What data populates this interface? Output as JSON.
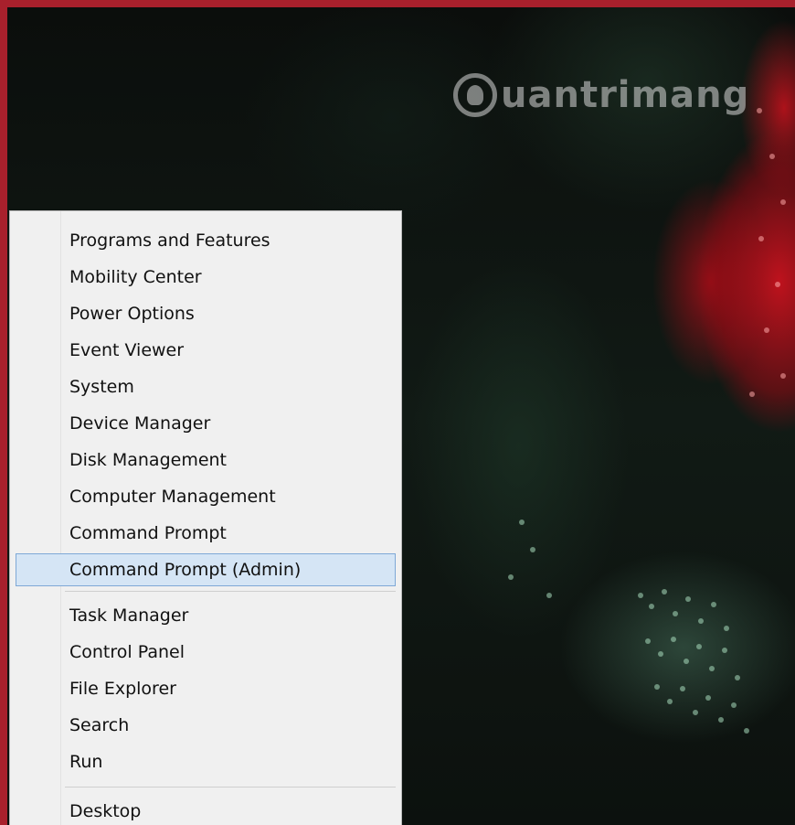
{
  "watermark": {
    "brand_text": "uantrimang",
    "logo_icon": "lightbulb-q-logo-icon"
  },
  "menu": {
    "groups": [
      {
        "items": [
          {
            "label": "Programs and Features",
            "highlighted": false
          },
          {
            "label": "Mobility Center",
            "highlighted": false
          },
          {
            "label": "Power Options",
            "highlighted": false
          },
          {
            "label": "Event Viewer",
            "highlighted": false
          },
          {
            "label": "System",
            "highlighted": false
          },
          {
            "label": "Device Manager",
            "highlighted": false
          },
          {
            "label": "Disk Management",
            "highlighted": false
          },
          {
            "label": "Computer Management",
            "highlighted": false
          },
          {
            "label": "Command Prompt",
            "highlighted": false
          },
          {
            "label": "Command Prompt (Admin)",
            "highlighted": true
          }
        ]
      },
      {
        "items": [
          {
            "label": "Task Manager",
            "highlighted": false
          },
          {
            "label": "Control Panel",
            "highlighted": false
          },
          {
            "label": "File Explorer",
            "highlighted": false
          },
          {
            "label": "Search",
            "highlighted": false
          },
          {
            "label": "Run",
            "highlighted": false
          }
        ]
      },
      {
        "items": [
          {
            "label": "Desktop",
            "highlighted": false
          }
        ]
      }
    ]
  },
  "colors": {
    "menu_background": "#f0f0f0",
    "highlight_background": "#d5e5f5",
    "highlight_border": "#7ea8d6",
    "window_frame": "#a8202c"
  }
}
